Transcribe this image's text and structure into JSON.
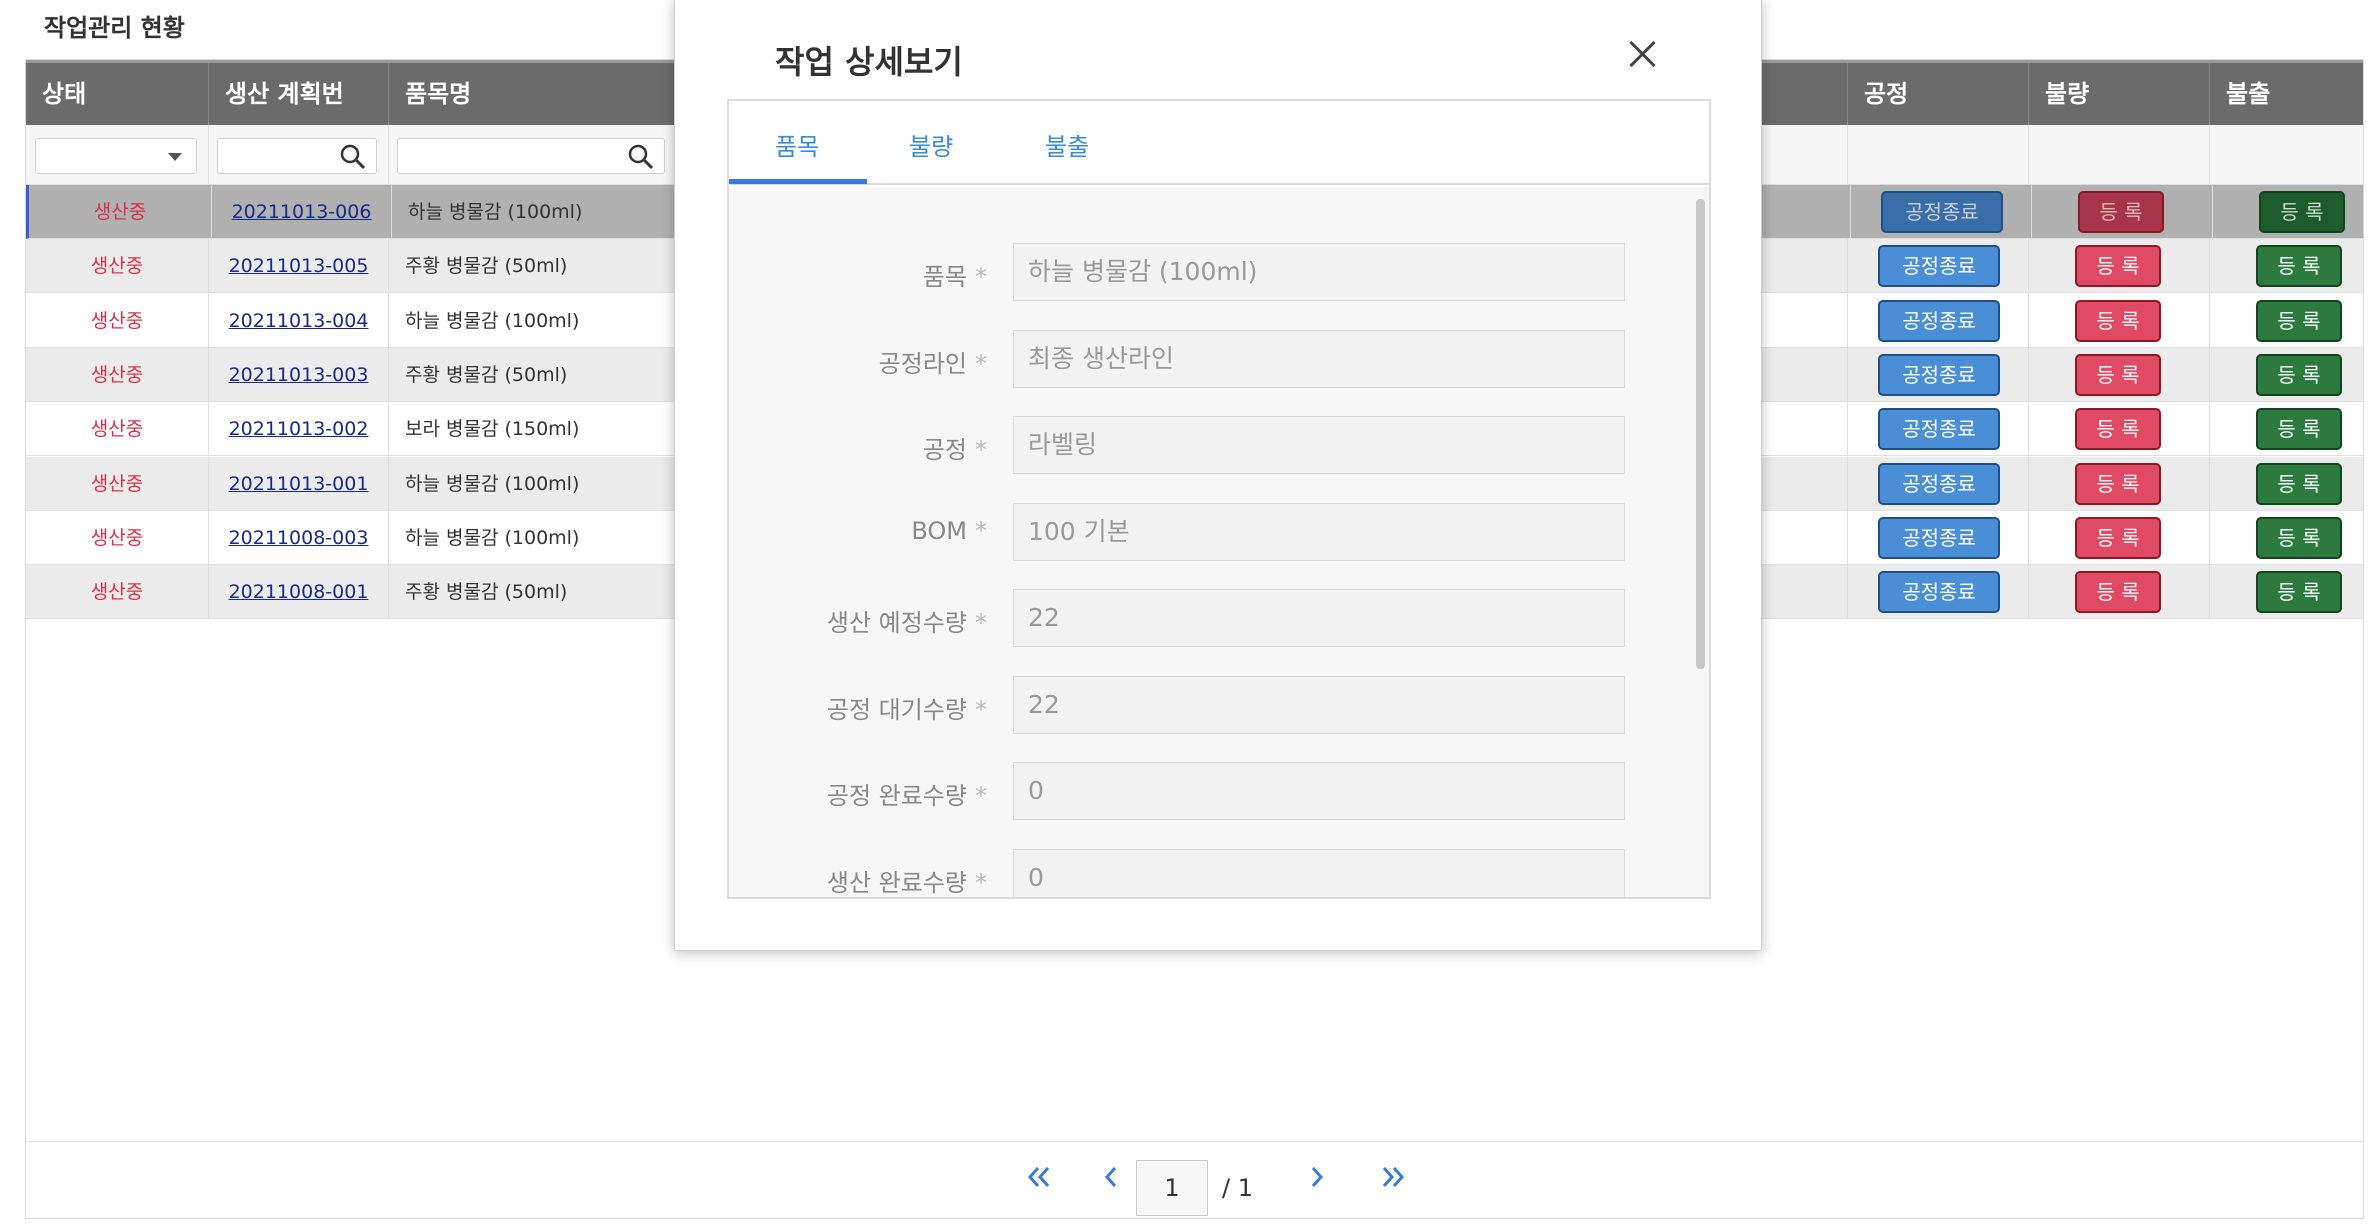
{
  "page": {
    "title": "작업관리 현황"
  },
  "table": {
    "columns": [
      "상태",
      "생산 계획번",
      "품목명",
      "공정",
      "불량",
      "불출"
    ],
    "rows": [
      {
        "status": "생산중",
        "plan": "20211013-006",
        "item": "하늘 병물감 (100ml)",
        "process_btn": "공정종료",
        "defect_btn": "등 록",
        "release_btn": "등 록"
      },
      {
        "status": "생산중",
        "plan": "20211013-005",
        "item": "주황 병물감 (50ml)",
        "process_btn": "공정종료",
        "defect_btn": "등 록",
        "release_btn": "등 록"
      },
      {
        "status": "생산중",
        "plan": "20211013-004",
        "item": "하늘 병물감 (100ml)",
        "process_btn": "공정종료",
        "defect_btn": "등 록",
        "release_btn": "등 록"
      },
      {
        "status": "생산중",
        "plan": "20211013-003",
        "item": "주황 병물감 (50ml)",
        "process_btn": "공정종료",
        "defect_btn": "등 록",
        "release_btn": "등 록"
      },
      {
        "status": "생산중",
        "plan": "20211013-002",
        "item": "보라 병물감 (150ml)",
        "process_btn": "공정종료",
        "defect_btn": "등 록",
        "release_btn": "등 록"
      },
      {
        "status": "생산중",
        "plan": "20211013-001",
        "item": "하늘 병물감 (100ml)",
        "process_btn": "공정종료",
        "defect_btn": "등 록",
        "release_btn": "등 록"
      },
      {
        "status": "생산중",
        "plan": "20211008-003",
        "item": "하늘 병물감 (100ml)",
        "process_btn": "공정종료",
        "defect_btn": "등 록",
        "release_btn": "등 록"
      },
      {
        "status": "생산중",
        "plan": "20211008-001",
        "item": "주황 병물감 (50ml)",
        "process_btn": "공정종료",
        "defect_btn": "등 록",
        "release_btn": "등 록"
      }
    ]
  },
  "pager": {
    "current": "1",
    "total": "/ 1"
  },
  "modal": {
    "title": "작업 상세보기",
    "tabs": [
      "품목",
      "불량",
      "불출"
    ],
    "fields": [
      {
        "label": "품목",
        "value": "하늘 병물감 (100ml)"
      },
      {
        "label": "공정라인",
        "value": "최종 생산라인"
      },
      {
        "label": "공정",
        "value": "라벨링"
      },
      {
        "label": "BOM",
        "value": "100 기본"
      },
      {
        "label": "생산 예정수량",
        "value": "22"
      },
      {
        "label": "공정 대기수량",
        "value": "22"
      },
      {
        "label": "공정 완료수량",
        "value": "0"
      },
      {
        "label": "생산 완료수량",
        "value": "0"
      }
    ]
  },
  "colors": {
    "header": "#6b6b6b",
    "status": "#d9304a",
    "blue": "#4a8fd6",
    "red": "#e04a63",
    "green": "#2d7a3e",
    "accent": "#3a7bd5"
  }
}
